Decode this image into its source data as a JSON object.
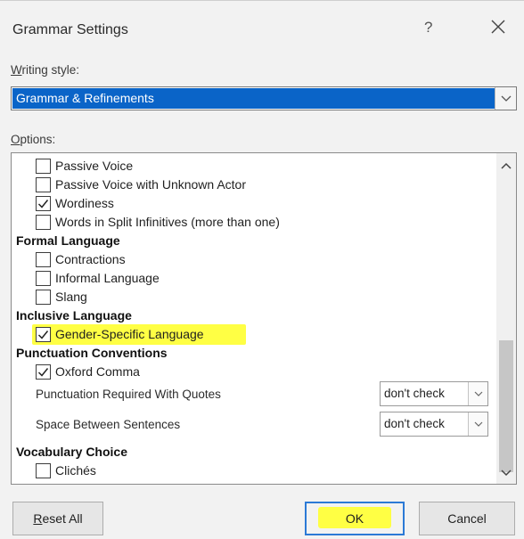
{
  "dialog": {
    "title": "Grammar Settings",
    "help_label": "?",
    "close_icon": "close-icon"
  },
  "writing_style": {
    "label_accel": "W",
    "label_rest": "riting style:",
    "selected": "Grammar & Refinements"
  },
  "options": {
    "label_accel": "O",
    "label_rest": "ptions:",
    "items": [
      {
        "label": "Passive Voice",
        "checked": false
      },
      {
        "label": "Passive Voice with Unknown Actor",
        "checked": false
      },
      {
        "label": "Wordiness",
        "checked": true
      },
      {
        "label": "Words in Split Infinitives (more than one)",
        "checked": false
      }
    ],
    "formal_language": {
      "heading": "Formal Language",
      "items": [
        {
          "label": "Contractions",
          "checked": false
        },
        {
          "label": "Informal Language",
          "checked": false
        },
        {
          "label": "Slang",
          "checked": false
        }
      ]
    },
    "inclusive_language": {
      "heading": "Inclusive Language",
      "items": [
        {
          "label": "Gender-Specific Language",
          "checked": true
        }
      ]
    },
    "punctuation": {
      "heading": "Punctuation Conventions",
      "items": [
        {
          "label": "Oxford Comma",
          "checked": true
        }
      ],
      "quotes_label": "Punctuation Required With Quotes",
      "quotes_value": "don't check",
      "spaces_label": "Space Between Sentences",
      "spaces_value": "don't check"
    },
    "vocabulary": {
      "heading": "Vocabulary Choice",
      "items": [
        {
          "label": "Clichés",
          "checked": false
        }
      ]
    }
  },
  "buttons": {
    "reset_accel": "R",
    "reset_rest": "eset All",
    "ok": "OK",
    "cancel": "Cancel"
  },
  "colors": {
    "selection_blue": "#0a64c8",
    "highlight_yellow": "#ffff44",
    "ok_border": "#2c7ad6"
  }
}
